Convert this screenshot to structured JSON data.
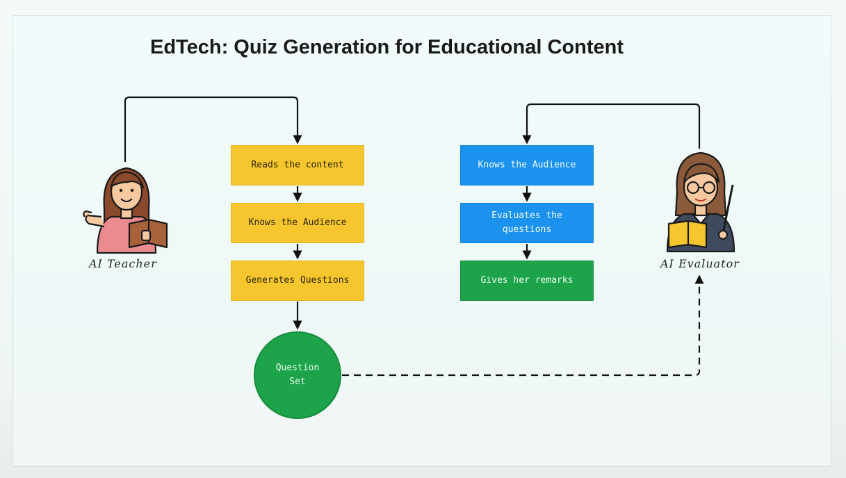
{
  "title": "EdTech: Quiz Generation for Educational Content",
  "teacher": {
    "label": "AI Teacher",
    "steps": [
      "Reads the content",
      "Knows the Audience",
      "Generates Questions"
    ]
  },
  "output": {
    "label": "Question Set"
  },
  "evaluator": {
    "label": "AI Evaluator",
    "steps": [
      "Knows the Audience",
      "Evaluates the questions",
      "Gives her remarks"
    ]
  },
  "colors": {
    "teacher_steps": "#f6c62f",
    "evaluator_steps": "#1b93ee",
    "final_step": "#1da34a",
    "question_set": "#1da34a"
  }
}
